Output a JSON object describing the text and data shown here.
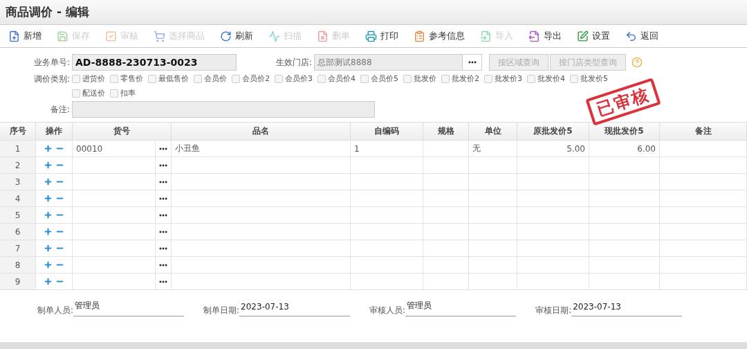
{
  "window": {
    "title": "商品调价 - 编辑"
  },
  "toolbar": [
    {
      "label": "新增",
      "disabled": false
    },
    {
      "label": "保存",
      "disabled": true
    },
    {
      "label": "审核",
      "disabled": true
    },
    {
      "label": "选择商品",
      "disabled": true
    },
    {
      "label": "刷新",
      "disabled": false
    },
    {
      "label": "扫描",
      "disabled": true
    },
    {
      "label": "删单",
      "disabled": true
    },
    {
      "label": "打印",
      "disabled": false
    },
    {
      "label": "参考信息",
      "disabled": false
    },
    {
      "label": "导入",
      "disabled": true
    },
    {
      "label": "导出",
      "disabled": false
    },
    {
      "label": "设置",
      "disabled": false
    },
    {
      "label": "返回",
      "disabled": false
    }
  ],
  "form": {
    "order_no": {
      "label": "业务单号:",
      "value": "AD-8888-230713-0023"
    },
    "store": {
      "label": "生效门店:",
      "value": "总部测试8888"
    },
    "query_buttons": [
      "按区域查询",
      "按门店类型查询"
    ],
    "category_label": "调价类别:",
    "categories": [
      {
        "label": "进货价",
        "checked": false
      },
      {
        "label": "零售价",
        "checked": false
      },
      {
        "label": "最低售价",
        "checked": false
      },
      {
        "label": "会员价",
        "checked": false
      },
      {
        "label": "会员价2",
        "checked": false
      },
      {
        "label": "会员价3",
        "checked": false
      },
      {
        "label": "会员价4",
        "checked": false
      },
      {
        "label": "会员价5",
        "checked": false
      },
      {
        "label": "批发价",
        "checked": false
      },
      {
        "label": "批发价2",
        "checked": false
      },
      {
        "label": "批发价3",
        "checked": false
      },
      {
        "label": "批发价4",
        "checked": false
      },
      {
        "label": "批发价5",
        "checked": false
      },
      {
        "label": "配送价",
        "checked": false
      },
      {
        "label": "扣率",
        "checked": false
      }
    ],
    "remark_label": "备注:"
  },
  "stamp": "已审核",
  "table": {
    "columns": [
      "序号",
      "操作",
      "货号",
      "品名",
      "自编码",
      "规格",
      "单位",
      "原批发价5",
      "现批发价5",
      "备注"
    ],
    "rows": [
      {
        "no": "1",
        "code": "00010",
        "name": "小丑鱼",
        "self_code": "1",
        "unit": "无",
        "old_price": "5.00",
        "new_price": "6.00"
      },
      {
        "no": "2"
      },
      {
        "no": "3"
      },
      {
        "no": "4"
      },
      {
        "no": "5"
      },
      {
        "no": "6"
      },
      {
        "no": "7"
      },
      {
        "no": "8"
      },
      {
        "no": "9"
      }
    ]
  },
  "footer": [
    {
      "label": "制单人员:",
      "value": "管理员"
    },
    {
      "label": "制单日期:",
      "value": "2023-07-13"
    },
    {
      "label": "审核人员:",
      "value": "管理员"
    },
    {
      "label": "审核日期:",
      "value": "2023-07-13"
    }
  ]
}
